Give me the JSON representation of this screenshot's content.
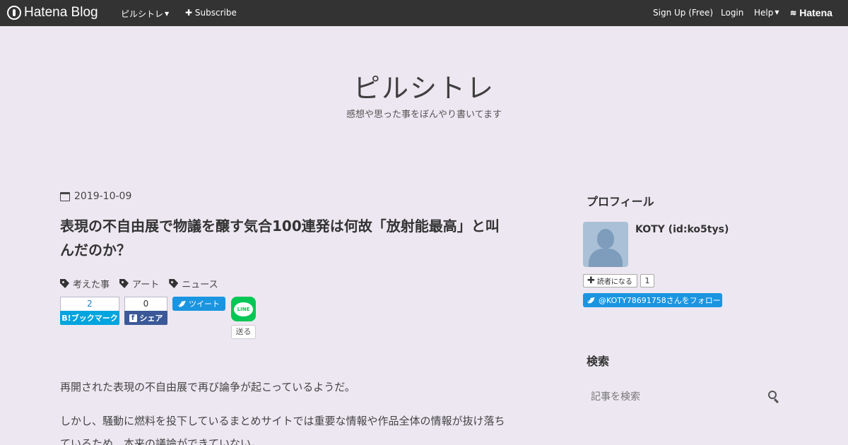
{
  "topbar": {
    "logo_text": "Hatena Blog",
    "blog_menu": "ピルシトレ",
    "subscribe": "Subscribe",
    "signup": "Sign Up (Free)",
    "login": "Login",
    "help": "Help",
    "hatena": "Hatena"
  },
  "header": {
    "title": "ピルシトレ",
    "description": "感想や思った事をぼんやり書いてます"
  },
  "entry": {
    "date": "2019-10-09",
    "title": "表現の不自由展で物議を醸す気合100連発は何故「放射能最高」と叫んだのか？",
    "tags": [
      "考えた事",
      "アート",
      "ニュース"
    ],
    "share": {
      "bookmark_count": "2",
      "bookmark_label": "B!ブックマーク",
      "facebook_count": "0",
      "facebook_label": "シェア",
      "tweet_label": "ツイート",
      "line_label": "LINE",
      "send_label": "送る"
    },
    "paragraphs": [
      "再開された表現の不自由展で再び論争が起こっているようだ。",
      "しかし、騒動に燃料を投下しているまとめサイトでは重要な情報や作品全体の情報が抜け落ちているため、本来の議論ができていない。"
    ]
  },
  "sidebar": {
    "profile_heading": "プロフィール",
    "profile_name": "KOTY (id:ko5tys)",
    "reader_label": "読者になる",
    "reader_count": "1",
    "follow_label": "@KOTY78691758さんをフォロー",
    "search_heading": "検索",
    "search_placeholder": "記事を検索"
  }
}
